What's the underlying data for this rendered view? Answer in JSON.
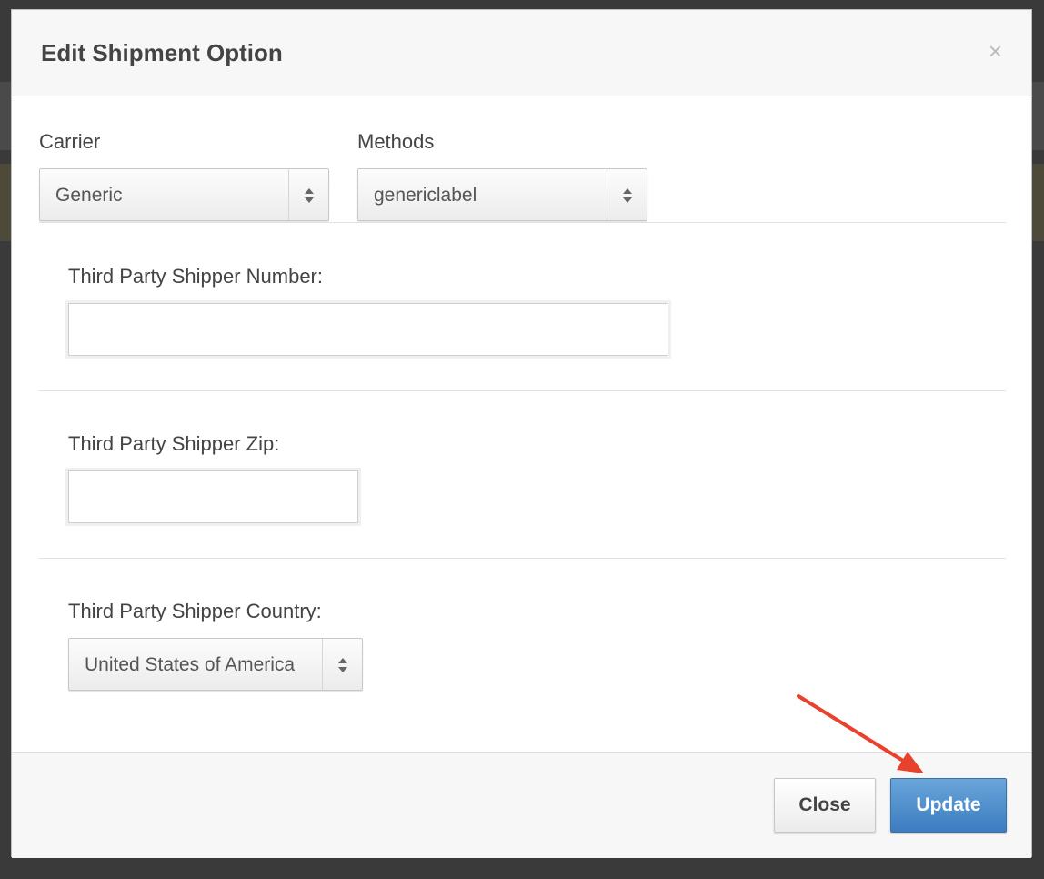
{
  "modal": {
    "title": "Edit Shipment Option",
    "close_icon": "×"
  },
  "carrier": {
    "label": "Carrier",
    "value": "Generic"
  },
  "methods": {
    "label": "Methods",
    "value": "genericlabel"
  },
  "third_party_number": {
    "label": "Third Party Shipper Number:",
    "value": ""
  },
  "third_party_zip": {
    "label": "Third Party Shipper Zip:",
    "value": ""
  },
  "third_party_country": {
    "label": "Third Party Shipper Country:",
    "value": "United States of America"
  },
  "footer": {
    "close_label": "Close",
    "update_label": "Update"
  },
  "colors": {
    "primary_button": "#4a8bcc",
    "annotation_arrow": "#e8412c"
  },
  "icons": {
    "close": "close-icon",
    "select_arrows": "updown-arrows-icon",
    "annotation": "red-pointer-arrow-icon"
  }
}
